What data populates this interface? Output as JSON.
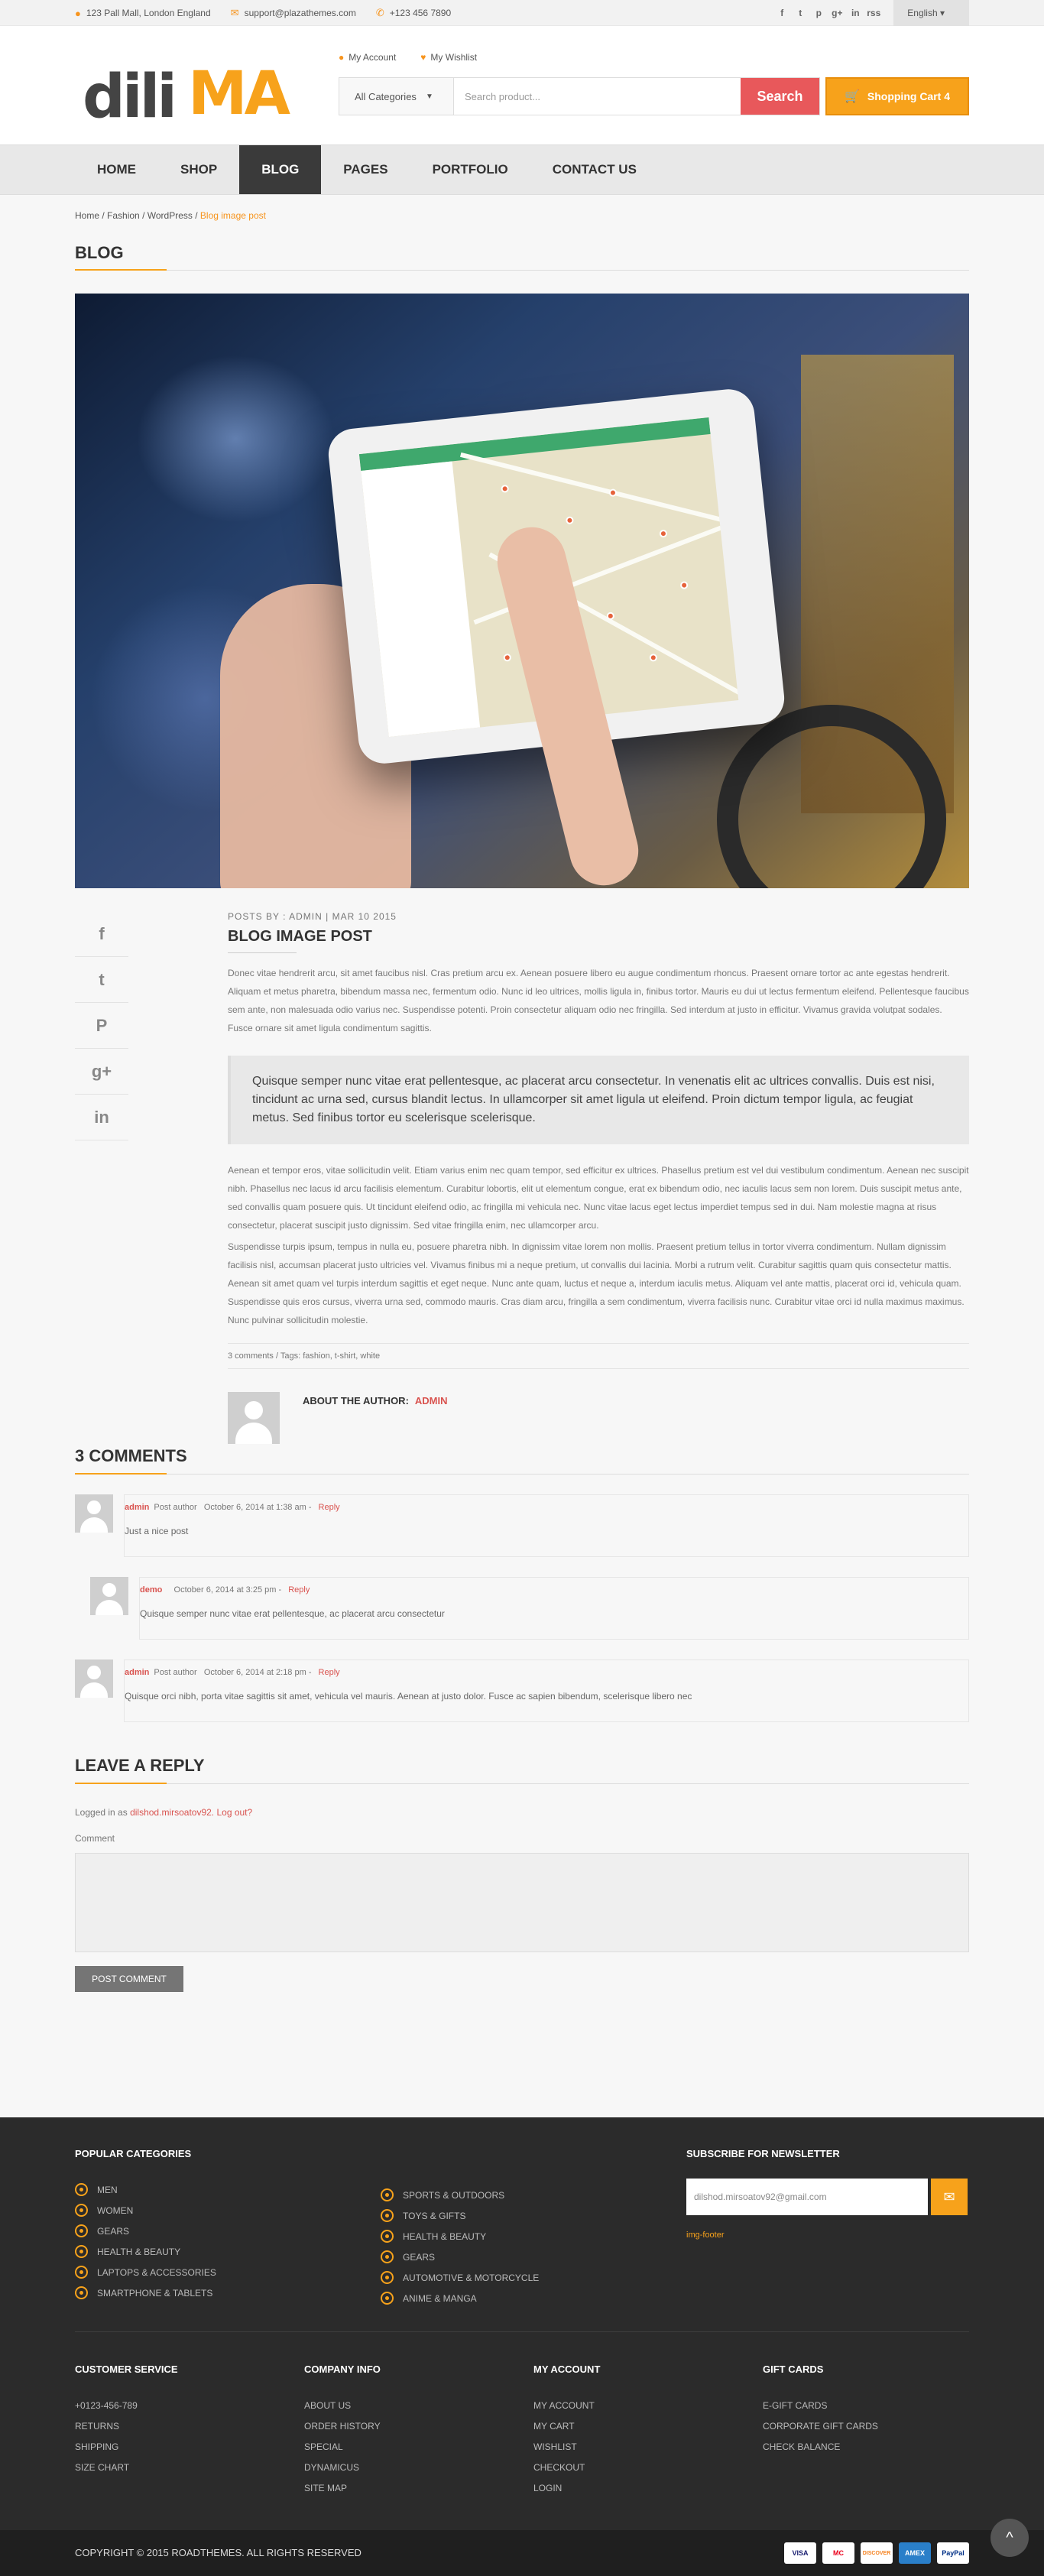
{
  "topbar": {
    "address": "123 Pall Mall, London England",
    "email": "support@plazathemes.com",
    "phone": "+123 456 7890",
    "social": [
      "f",
      "t",
      "p",
      "g+",
      "in",
      "rss"
    ],
    "language": "English"
  },
  "header": {
    "logo_left": "dili",
    "logo_right": "MA",
    "my_account": "My Account",
    "my_wishlist": "My Wishlist",
    "search_category": "All Categories",
    "search_placeholder": "Search product...",
    "search_button": "Search",
    "cart_label": "Shopping Cart 4"
  },
  "nav": [
    "Home",
    "Shop",
    "Blog",
    "Pages",
    "Portfolio",
    "Contact Us"
  ],
  "breadcrumb": [
    "Home",
    "Fashion",
    "WordPress",
    "Blog image post"
  ],
  "page_title": "BLOG",
  "post": {
    "meta": "POSTS BY :   ADMIN | MAR 10 2015",
    "title": "BLOG IMAGE POST",
    "para1": "Donec vitae hendrerit arcu, sit amet faucibus nisl. Cras pretium arcu ex. Aenean posuere libero eu augue condimentum rhoncus. Praesent ornare tortor ac ante egestas hendrerit. Aliquam et metus pharetra, bibendum massa nec, fermentum odio. Nunc id leo ultrices, mollis ligula in, finibus tortor. Mauris eu dui ut lectus fermentum eleifend. Pellentesque faucibus sem ante, non malesuada odio varius nec. Suspendisse potenti. Proin consectetur aliquam odio nec fringilla. Sed interdum at justo in efficitur. Vivamus gravida volutpat sodales. Fusce ornare sit amet ligula condimentum sagittis.",
    "quote": "Quisque semper nunc vitae erat pellentesque, ac placerat arcu consectetur. In venenatis elit ac ultrices convallis. Duis est nisi, tincidunt ac urna sed, cursus blandit lectus. In ullamcorper sit amet ligula ut eleifend. Proin dictum tempor ligula, ac feugiat metus. Sed finibus tortor eu scelerisque scelerisque.",
    "para2": "Aenean et tempor eros, vitae sollicitudin velit. Etiam varius enim nec quam tempor, sed efficitur ex ultrices. Phasellus pretium est vel dui vestibulum condimentum. Aenean nec suscipit nibh. Phasellus nec lacus id arcu facilisis elementum. Curabitur lobortis, elit ut elementum congue, erat ex bibendum odio, nec iaculis lacus sem non lorem. Duis suscipit metus ante, sed convallis quam posuere quis. Ut tincidunt eleifend odio, ac fringilla mi vehicula nec. Nunc vitae lacus eget lectus imperdiet tempus sed in dui. Nam molestie magna at risus consectetur, placerat suscipit justo dignissim. Sed vitae fringilla enim, nec ullamcorper arcu.",
    "para3": "Suspendisse turpis ipsum, tempus in nulla eu, posuere pharetra nibh. In dignissim vitae lorem non mollis. Praesent pretium tellus in tortor viverra condimentum. Nullam dignissim facilisis nisl, accumsan placerat justo ultricies vel. Vivamus finibus mi a neque pretium, ut convallis dui lacinia. Morbi a rutrum velit. Curabitur sagittis quam quis consectetur mattis. Aenean sit amet quam vel turpis interdum sagittis et eget neque. Nunc ante quam, luctus et neque a, interdum iaculis metus. Aliquam vel ante mattis, placerat orci id, vehicula quam. Suspendisse quis eros cursus, viverra urna sed, commodo mauris. Cras diam arcu, fringilla a sem condimentum, viverra facilisis nunc. Curabitur vitae orci id nulla maximus maximus. Nunc pulvinar sollicitudin molestie.",
    "tags": "3 comments / Tags: fashion, t-shirt, white",
    "author_label": "ABOUT THE AUTHOR:",
    "author_name": "ADMIN"
  },
  "comments": {
    "heading": "3 COMMENTS",
    "items": [
      {
        "author": "admin",
        "role": "Post author",
        "date": "October 6, 2014 at 1:38 am",
        "reply": "Reply",
        "text": "Just a nice post"
      },
      {
        "author": "demo",
        "role": "",
        "date": "October 6, 2014 at 3:25 pm",
        "reply": "Reply",
        "text": "Quisque semper nunc vitae erat pellentesque, ac placerat arcu consectetur"
      },
      {
        "author": "admin",
        "role": "Post author",
        "date": "October 6, 2014 at 2:18 pm",
        "reply": "Reply",
        "text": "Quisque orci nibh, porta vitae sagittis sit amet, vehicula vel mauris. Aenean at justo dolor. Fusce ac sapien bibendum, scelerisque libero nec"
      }
    ]
  },
  "reply": {
    "heading": "LEAVE A REPLY",
    "logged_prefix": "Logged in as",
    "logged_user": "dilshod.mirsoatov92. Log out?",
    "comment_label": "Comment",
    "button": "POST COMMENT"
  },
  "footer": {
    "popular_heading": "POPULAR CATEGORIES",
    "popular_col1": [
      "Men",
      "Women",
      "Gears",
      "Health & Beauty",
      "Laptops & Accessories",
      "Smartphone & Tablets"
    ],
    "popular_col2": [
      "Sports & Outdoors",
      "Toys & Gifts",
      "Health & Beauty",
      "Gears",
      "Automotive & Motorcycle",
      "Anime & Manga"
    ],
    "newsletter_heading": "SUBSCRIBE FOR NEWSLETTER",
    "newsletter_value": "dilshod.mirsoatov92@gmail.com",
    "img_alt": "img-footer",
    "customer_heading": "CUSTOMER SERVICE",
    "customer_items": [
      "+0123-456-789",
      "Returns",
      "Shipping",
      "Size Chart"
    ],
    "company_heading": "COMPANY INFO",
    "company_items": [
      "About Us",
      "Order History",
      "Special",
      "Dynamicus",
      "Site Map"
    ],
    "account_heading": "MY ACCOUNT",
    "account_items": [
      "My Account",
      "My Cart",
      "Wishlist",
      "Checkout",
      "Login"
    ],
    "gift_heading": "GIFT CARDS",
    "gift_items": [
      "E-Gift Cards",
      "Corporate Gift Cards",
      "Check Balance"
    ],
    "copyright": "COPYRIGHT © 2015 ROADTHEMES. ALL RIGHTS RESERVED",
    "payments": [
      "VISA",
      "MC",
      "DISCOVER",
      "AMEX",
      "PayPal"
    ]
  }
}
